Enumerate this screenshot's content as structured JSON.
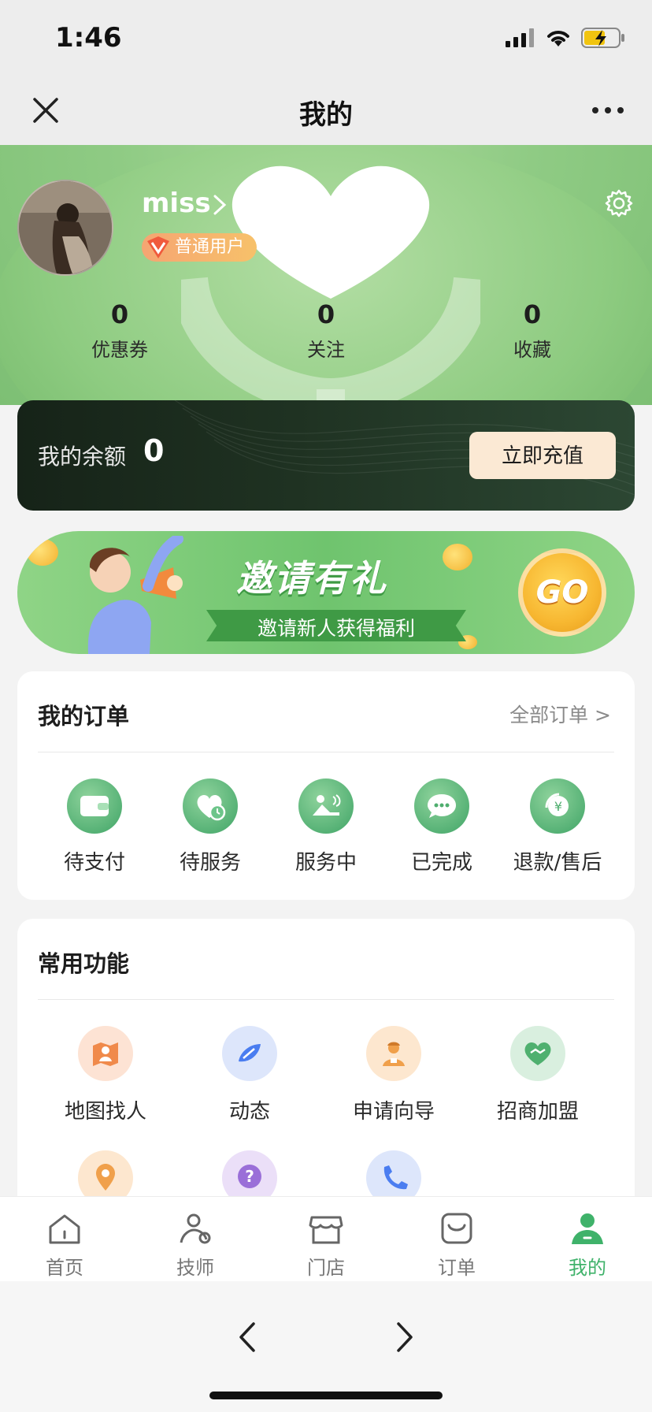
{
  "status_bar": {
    "time": "1:46"
  },
  "nav": {
    "title": "我的",
    "close_icon": "close-icon",
    "more_icon": "more-icon"
  },
  "profile": {
    "username": "miss",
    "badge": "普通用户",
    "stats": [
      {
        "value": "0",
        "label": "优惠券"
      },
      {
        "value": "0",
        "label": "关注"
      },
      {
        "value": "0",
        "label": "收藏"
      }
    ]
  },
  "balance": {
    "label": "我的余额",
    "value": "0",
    "button": "立即充值"
  },
  "invite": {
    "title": "邀请有礼",
    "subtitle": "邀请新人获得福利",
    "go": "GO"
  },
  "orders": {
    "title": "我的订单",
    "all_link": "全部订单 >",
    "items": [
      {
        "label": "待支付",
        "icon": "wallet-icon"
      },
      {
        "label": "待服务",
        "icon": "heart-clock-icon"
      },
      {
        "label": "服务中",
        "icon": "massage-icon"
      },
      {
        "label": "已完成",
        "icon": "chat-bubble-icon"
      },
      {
        "label": "退款/售后",
        "icon": "refund-icon"
      }
    ]
  },
  "functions": {
    "title": "常用功能",
    "items": [
      {
        "label": "地图找人",
        "icon": "map-person-icon",
        "color": "#f08a4b"
      },
      {
        "label": "动态",
        "icon": "feed-icon",
        "color": "#4a7df0"
      },
      {
        "label": "申请向导",
        "icon": "guide-icon",
        "color": "#f0a04b"
      },
      {
        "label": "招商加盟",
        "icon": "handshake-icon",
        "color": "#4fb06f"
      },
      {
        "label": "",
        "icon": "location-pin-icon",
        "color": "#f0a04b"
      },
      {
        "label": "",
        "icon": "help-icon",
        "color": "#9a6fd8"
      },
      {
        "label": "",
        "icon": "phone-icon",
        "color": "#4a7df0"
      }
    ]
  },
  "tabbar": {
    "active_color": "#3fb26a",
    "items": [
      {
        "label": "首页",
        "icon": "home-icon"
      },
      {
        "label": "技师",
        "icon": "technician-icon"
      },
      {
        "label": "门店",
        "icon": "store-icon"
      },
      {
        "label": "订单",
        "icon": "order-bag-icon"
      },
      {
        "label": "我的",
        "icon": "profile-icon"
      }
    ]
  }
}
